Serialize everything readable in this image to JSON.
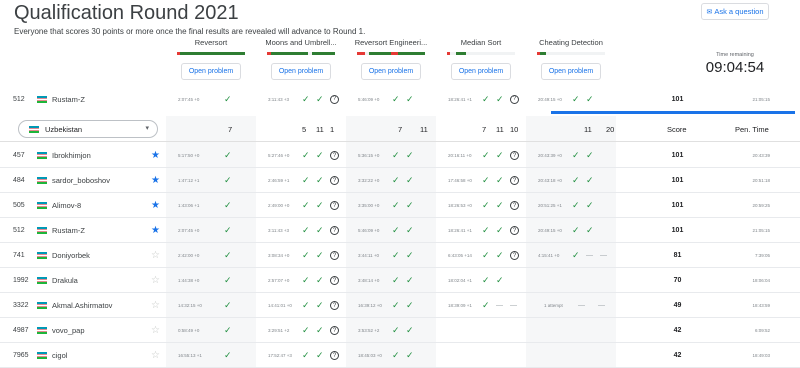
{
  "title": "Qualification Round 2021",
  "subtitle": "Everyone that scores 30 points or more once the final results are revealed will advance to Round 1.",
  "ask_button": "Ask a question",
  "problems": [
    {
      "name": "Reversort",
      "open": "Open problem",
      "bar": [
        [
          "#e53935",
          0.05
        ],
        [
          "#2e7d32",
          0.95
        ]
      ]
    },
    {
      "name": "Moons and Umbrell...",
      "open": "Open problem",
      "bar": [
        [
          "#e53935",
          0.06
        ],
        [
          "#2e7d32",
          0.54
        ],
        [
          "#f1f3f4",
          0.06
        ],
        [
          "#2e7d32",
          0.34
        ]
      ]
    },
    {
      "name": "Reversort Engineeri...",
      "open": "Open problem",
      "bar": [
        [
          "#e53935",
          0.12
        ],
        [
          "#f1f3f4",
          0.06
        ],
        [
          "#2e7d32",
          0.32
        ],
        [
          "#e53935",
          0.1
        ],
        [
          "#2e7d32",
          0.4
        ]
      ]
    },
    {
      "name": "Median Sort",
      "open": "Open problem",
      "bar": [
        [
          "#e53935",
          0.05
        ],
        [
          "#f1f3f4",
          0.08
        ],
        [
          "#2e7d32",
          0.15
        ],
        [
          "#f1f3f4",
          0.72
        ]
      ]
    },
    {
      "name": "Cheating Detection",
      "open": "Open problem",
      "bar": [
        [
          "#e53935",
          0.05
        ],
        [
          "#2e7d32",
          0.08
        ],
        [
          "#f1f3f4",
          0.87
        ]
      ]
    }
  ],
  "time_label": "Time remaining",
  "time_value": "09:04:54",
  "my_row": {
    "rank": "512",
    "name": "Rustam-Z",
    "score": "101",
    "pen": "21:05:15",
    "cells": [
      {
        "t": "2:07:45 +0",
        "s": "chk"
      },
      {
        "t": "3:11:43 +3",
        "s": "chk2q"
      },
      {
        "t": "5:46:09 +0",
        "s": "chk2"
      },
      {
        "t": "18:26:41 +1",
        "s": "chk2q"
      },
      {
        "t": "20:49:15 +0",
        "s": "chk2"
      }
    ]
  },
  "header": {
    "country": "Uzbekistan",
    "counts": [
      [
        "7"
      ],
      [
        "5",
        "11",
        "1"
      ],
      [
        "7",
        "11"
      ],
      [
        "7",
        "11",
        "10"
      ],
      [
        "11",
        "20"
      ]
    ],
    "score_label": "Score",
    "pen_label": "Pen. Time"
  },
  "rows": [
    {
      "rank": "457",
      "name": "Ibrokhimjon",
      "star": true,
      "score": "101",
      "pen": "20:43:39",
      "cells": [
        {
          "t": "5:17:50 +0",
          "s": "chk"
        },
        {
          "t": "5:27:46 +0",
          "s": "chk2q"
        },
        {
          "t": "5:36:15 +0",
          "s": "chk2"
        },
        {
          "t": "20:16:11 +0",
          "s": "chk2q"
        },
        {
          "t": "20:43:39 +0",
          "s": "chk2"
        }
      ]
    },
    {
      "rank": "484",
      "name": "sardor_boboshov",
      "star": true,
      "score": "101",
      "pen": "20:51:18",
      "cells": [
        {
          "t": "1:47:12 +1",
          "s": "chk"
        },
        {
          "t": "2:46:59 +1",
          "s": "chk2q"
        },
        {
          "t": "3:32:22 +0",
          "s": "chk2"
        },
        {
          "t": "17:46:58 +0",
          "s": "chk2q"
        },
        {
          "t": "20:43:18 +0",
          "s": "chk2"
        }
      ]
    },
    {
      "rank": "505",
      "name": "Alimov-8",
      "star": true,
      "score": "101",
      "pen": "20:59:25",
      "cells": [
        {
          "t": "1:43:06 +1",
          "s": "chk"
        },
        {
          "t": "2:49:00 +0",
          "s": "chk2q"
        },
        {
          "t": "3:35:00 +0",
          "s": "chk2"
        },
        {
          "t": "18:26:53 +0",
          "s": "chk2q"
        },
        {
          "t": "20:51:25 +1",
          "s": "chk2"
        }
      ]
    },
    {
      "rank": "512",
      "name": "Rustam-Z",
      "star": true,
      "score": "101",
      "pen": "21:05:15",
      "cells": [
        {
          "t": "2:07:45 +0",
          "s": "chk"
        },
        {
          "t": "3:11:43 +3",
          "s": "chk2q"
        },
        {
          "t": "5:46:09 +0",
          "s": "chk2"
        },
        {
          "t": "18:26:41 +1",
          "s": "chk2q"
        },
        {
          "t": "20:49:15 +0",
          "s": "chk2"
        }
      ]
    },
    {
      "rank": "741",
      "name": "Doniyorbek",
      "star": false,
      "score": "81",
      "pen": "7:39:05",
      "cells": [
        {
          "t": "2:42:00 +0",
          "s": "chk"
        },
        {
          "t": "3:08:34 +0",
          "s": "chk2q"
        },
        {
          "t": "3:44:11 +0",
          "s": "chk2"
        },
        {
          "t": "6:43:05 +14",
          "s": "chk2q"
        },
        {
          "t": "4:15:41 +0",
          "s": "chkdash"
        }
      ]
    },
    {
      "rank": "1992",
      "name": "Drakula",
      "star": false,
      "score": "70",
      "pen": "18:06:04",
      "cells": [
        {
          "t": "1:44:38 +0",
          "s": "chk"
        },
        {
          "t": "2:57:07 +0",
          "s": "chk2q"
        },
        {
          "t": "3:48:14 +0",
          "s": "chk2"
        },
        {
          "t": "18:02:04 +1",
          "s": "chk2"
        },
        {
          "t": "",
          "s": "empty"
        }
      ]
    },
    {
      "rank": "3322",
      "name": "Akmal.Ashirmatov",
      "star": false,
      "score": "49",
      "pen": "18:43:59",
      "cells": [
        {
          "t": "14:32:15 +0",
          "s": "chk"
        },
        {
          "t": "14:41:01 +0",
          "s": "chk2q"
        },
        {
          "t": "16:39:12 +0",
          "s": "chk2"
        },
        {
          "t": "18:39:09 +1",
          "s": "chkdash"
        },
        {
          "t": "1 attempt",
          "s": "dash2"
        }
      ]
    },
    {
      "rank": "4987",
      "name": "vovo_pap",
      "star": false,
      "score": "42",
      "pen": "6:09:52",
      "cells": [
        {
          "t": "0:58:49 +0",
          "s": "chk"
        },
        {
          "t": "3:29:51 +2",
          "s": "chk2q"
        },
        {
          "t": "3:53:52 +2",
          "s": "chk2"
        },
        {
          "t": "",
          "s": "empty"
        },
        {
          "t": "",
          "s": "empty"
        }
      ]
    },
    {
      "rank": "7965",
      "name": "cigol",
      "star": false,
      "score": "42",
      "pen": "18:49:03",
      "cells": [
        {
          "t": "16:55:13 +1",
          "s": "chk"
        },
        {
          "t": "17:52:47 +3",
          "s": "chk2q"
        },
        {
          "t": "18:45:03 +0",
          "s": "chk2"
        },
        {
          "t": "",
          "s": "empty"
        },
        {
          "t": "",
          "s": "empty"
        }
      ]
    }
  ]
}
